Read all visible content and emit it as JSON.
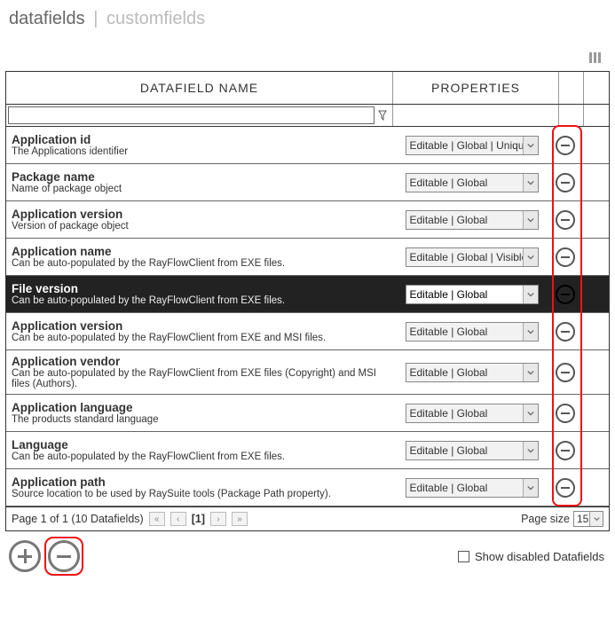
{
  "breadcrumb": {
    "main": "datafields",
    "sub": "customfields"
  },
  "headers": {
    "name": "DATAFIELD NAME",
    "props": "PROPERTIES"
  },
  "filter": {
    "value": ""
  },
  "rows": [
    {
      "name": "Application id",
      "desc": "The Applications identifier",
      "props": "Editable | Global | Unique |",
      "selected": false
    },
    {
      "name": "Package name",
      "desc": "Name of package object",
      "props": "Editable | Global",
      "selected": false
    },
    {
      "name": "Application version",
      "desc": "Version of package object",
      "props": "Editable | Global",
      "selected": false
    },
    {
      "name": "Application name",
      "desc": "Can be auto-populated by the RayFlowClient from EXE files.",
      "props": "Editable | Global | Visible",
      "selected": false
    },
    {
      "name": "File version",
      "desc": "Can be auto-populated by the RayFlowClient from EXE files.",
      "props": "Editable | Global",
      "selected": true
    },
    {
      "name": "Application version",
      "desc": "Can be auto-populated by the RayFlowClient from EXE and MSI files.",
      "props": "Editable | Global",
      "selected": false
    },
    {
      "name": "Application vendor",
      "desc": "Can be auto-populated by the RayFlowClient from EXE files (Copyright) and MSI files (Authors).",
      "props": "Editable | Global",
      "selected": false
    },
    {
      "name": "Application language",
      "desc": "The products standard language",
      "props": "Editable | Global",
      "selected": false
    },
    {
      "name": "Language",
      "desc": "Can be auto-populated by the RayFlowClient from EXE files.",
      "props": "Editable | Global",
      "selected": false
    },
    {
      "name": "Application path",
      "desc": "Source location to be used by RaySuite tools (Package Path property).",
      "props": "Editable | Global",
      "selected": false
    }
  ],
  "pager": {
    "summary": "Page 1 of 1 (10 Datafields)",
    "current": "[1]",
    "size_label": "Page size",
    "size_value": "15"
  },
  "footer": {
    "show_disabled_label": "Show disabled Datafields",
    "show_disabled_checked": false
  }
}
